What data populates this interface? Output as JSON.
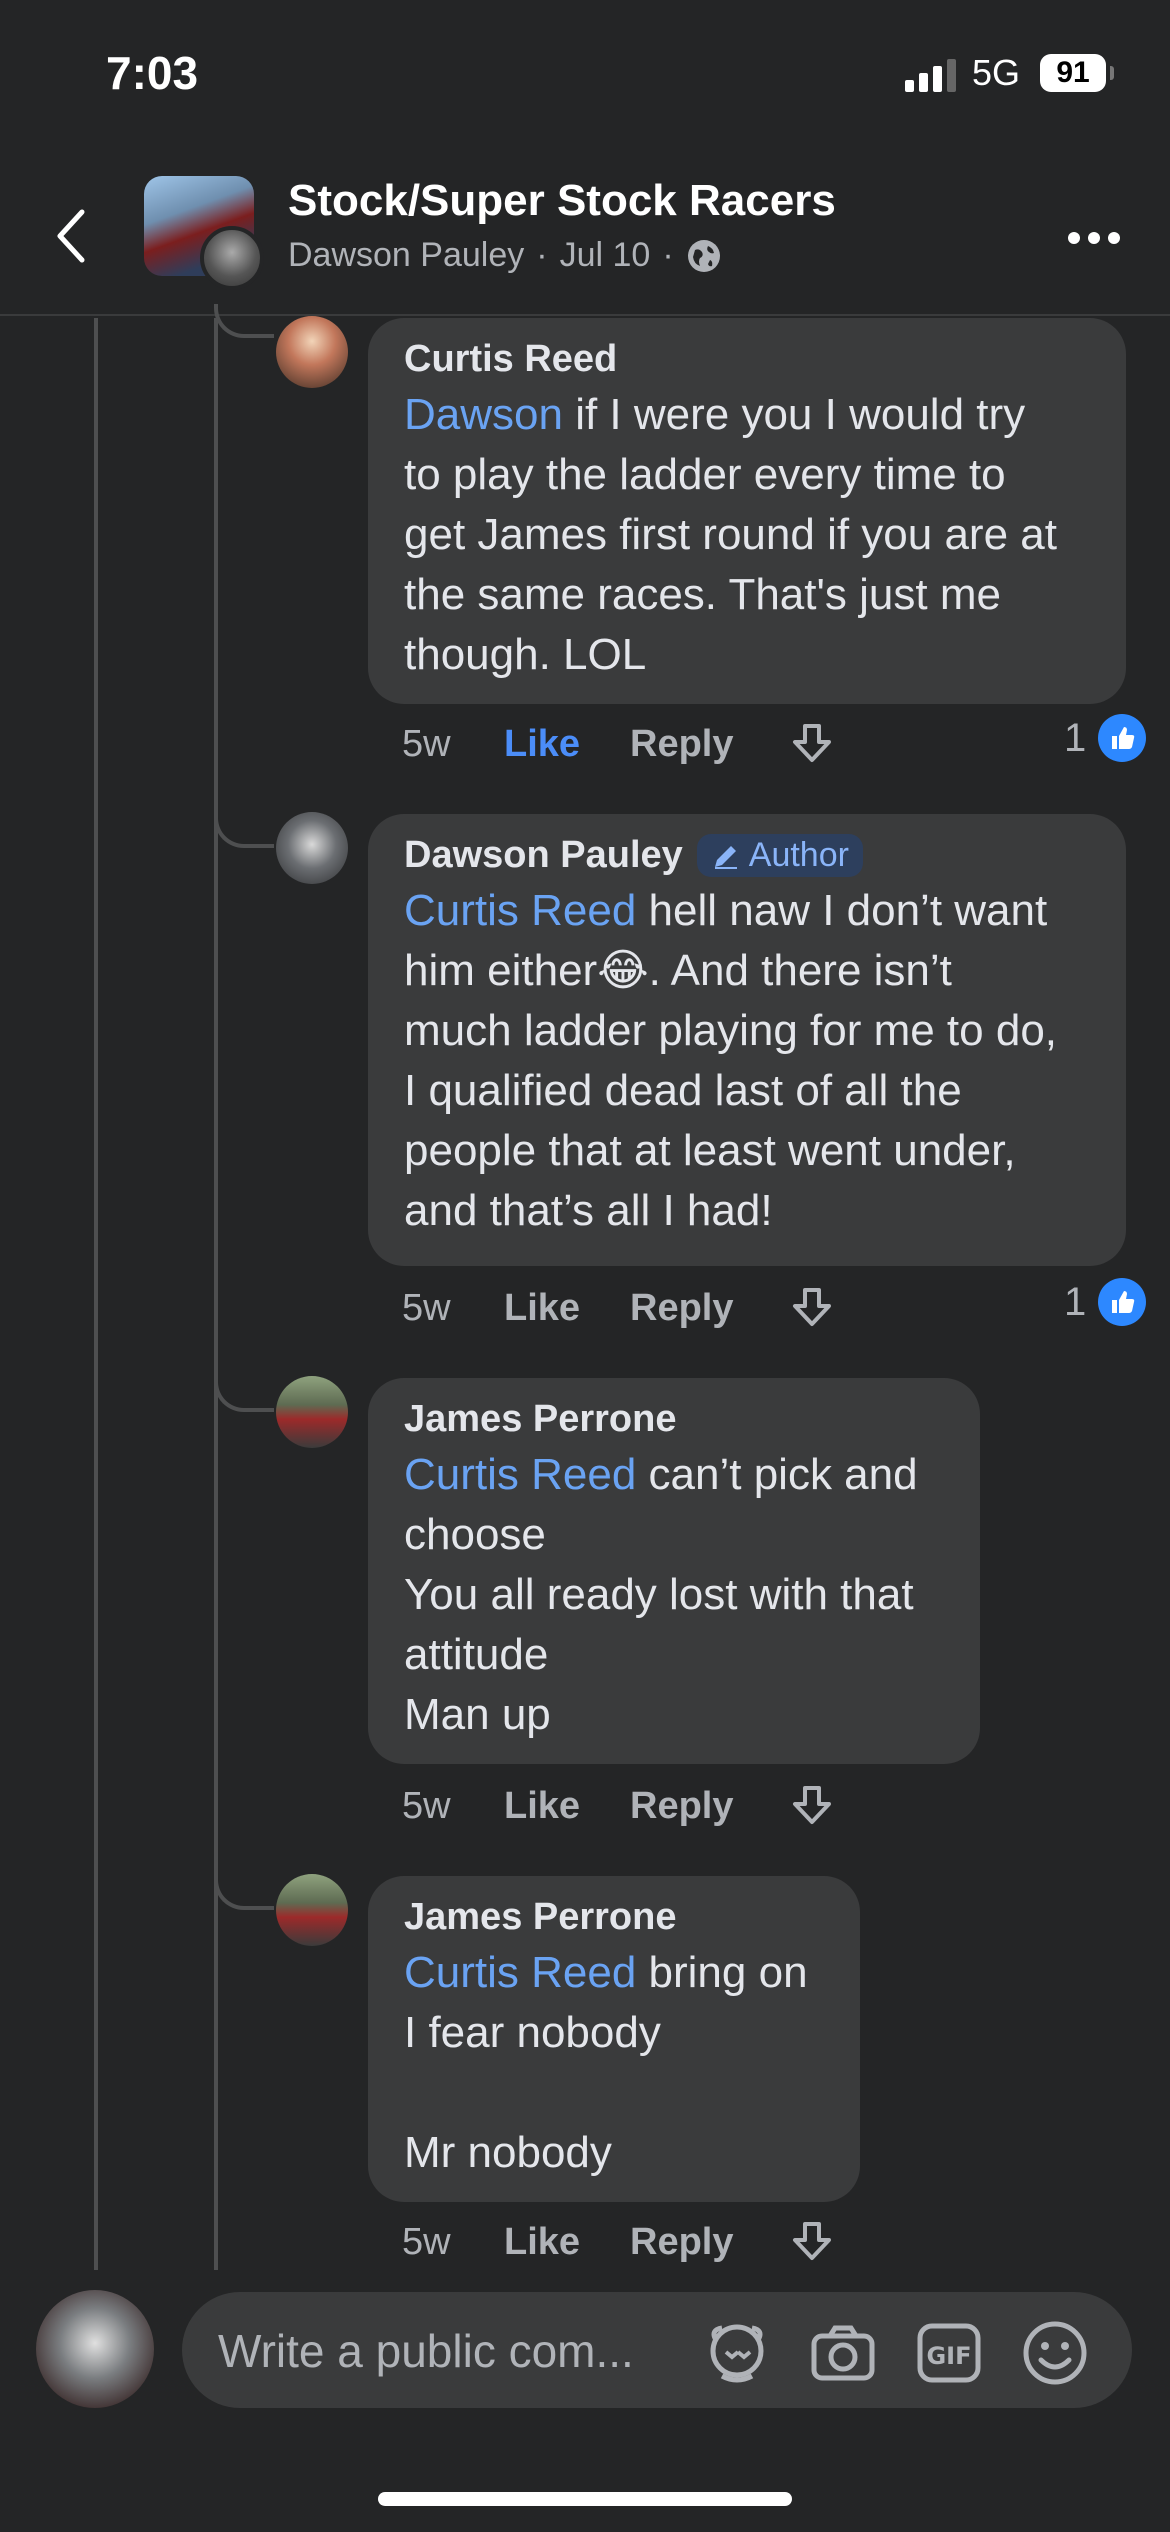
{
  "status_bar": {
    "time": "7:03",
    "network": "5G",
    "battery": "91"
  },
  "header": {
    "group_name": "Stock/Super Stock Racers",
    "author": "Dawson Pauley",
    "date": "Jul 10",
    "sep": "·"
  },
  "comments": [
    {
      "name": "Curtis Reed",
      "mention": "Dawson",
      "text": " if I were you I would try\nto play the ladder every time to\nget James first round if you are at\nthe same races. That's just me\nthough. LOL",
      "age": "5w",
      "like": "Like",
      "reply": "Reply",
      "reactions": "1",
      "liked": true
    },
    {
      "name": "Dawson Pauley",
      "badge": "Author",
      "mention": "Curtis Reed",
      "text": " hell naw I don’t want\nhim either😂. And there isn’t\nmuch ladder playing for me to do,\nI qualified dead last of all the\npeople that at least went under,\nand that’s all I had!",
      "age": "5w",
      "like": "Like",
      "reply": "Reply",
      "reactions": "1"
    },
    {
      "name": "James Perrone",
      "mention": "Curtis Reed",
      "text": " can’t pick and\nchoose\nYou all ready lost with that\nattitude\nMan up",
      "age": "5w",
      "like": "Like",
      "reply": "Reply"
    },
    {
      "name": "James Perrone",
      "mention": "Curtis Reed",
      "text": " bring on\nI fear nobody\n\nMr nobody",
      "age": "5w",
      "like": "Like",
      "reply": "Reply"
    }
  ],
  "composer": {
    "placeholder": "Write a public com..."
  },
  "icons": [
    "back-chevron-icon",
    "globe-icon",
    "more-icon",
    "downvote-icon",
    "like-reaction-icon",
    "avatar-sticker-icon",
    "camera-icon",
    "gif-icon",
    "emoji-icon"
  ],
  "colors": {
    "background": "#242526",
    "bubble": "#3a3b3c",
    "mention": "#6aa3f3",
    "like_active": "#4b8df8",
    "reaction": "#2d88ff"
  }
}
